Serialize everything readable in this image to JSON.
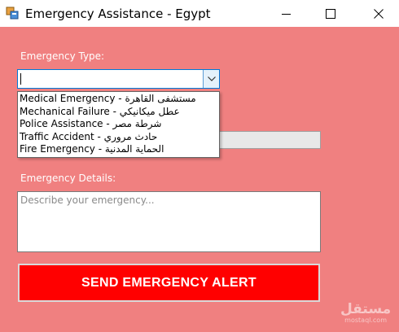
{
  "window": {
    "title": "Emergency Assistance - Egypt",
    "icon": "winforms-app-icon",
    "controls": [
      "minimize-icon",
      "maximize-icon",
      "close-icon"
    ]
  },
  "form": {
    "type_label": "Emergency Type:",
    "type_value": "",
    "type_options": [
      "Medical Emergency - مستشفى القاهرة",
      "Mechanical Failure - عطل ميكانيكي",
      "Police Assistance - شرطة مصر",
      "Traffic Accident - حادث مروري",
      "Fire Emergency - الحماية المدنية"
    ],
    "details_label": "Emergency Details:",
    "details_placeholder": "Describe your emergency...",
    "send_label": "SEND EMERGENCY ALERT"
  },
  "watermark": {
    "main": "مستقل",
    "sub": "mostaql.com"
  },
  "colors": {
    "background": "#f08080",
    "send_button": "#ff0000",
    "label_text": "#ffffff"
  }
}
